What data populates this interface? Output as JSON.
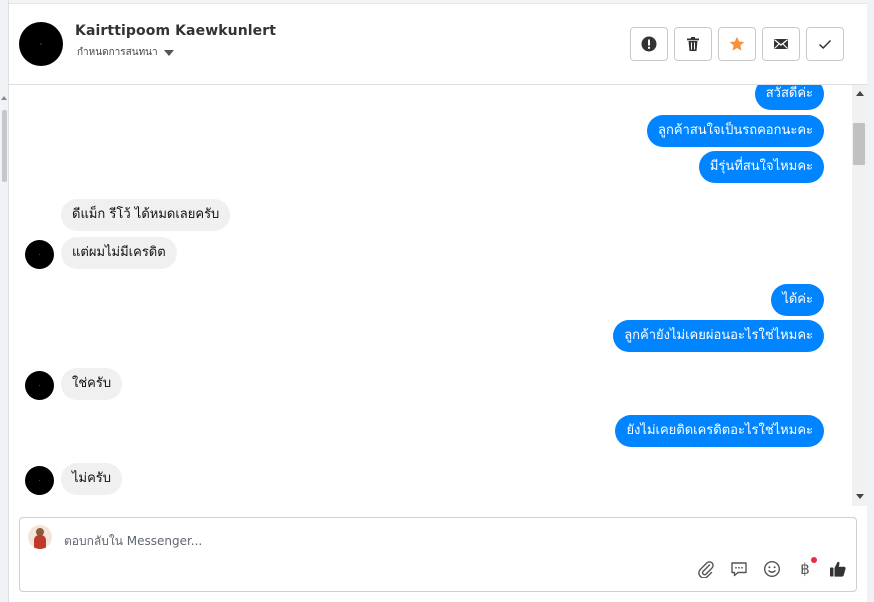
{
  "header": {
    "contact_name": "Kairttipoom Kaewkunlert",
    "assign_label": "กำหนดการสนทนา"
  },
  "actions": {
    "icons": [
      "alert-icon",
      "trash-icon",
      "star-icon",
      "mail-icon",
      "check-icon"
    ],
    "star_color": "#f7923a"
  },
  "messages": [
    {
      "side": "out",
      "text": "สวัสดีค่ะ"
    },
    {
      "side": "out",
      "text": "ลูกค้าสนใจเป็นรถคอกนะคะ"
    },
    {
      "side": "out",
      "text": "มีรุ่นที่สนใจไหมคะ"
    },
    {
      "side": "in",
      "text": "ดีแม็ก รีโว้ ได้หมดเลยครับ"
    },
    {
      "side": "in",
      "text": "แต่ผมไม่มีเครดิต"
    },
    {
      "side": "out",
      "text": "ได้ค่ะ"
    },
    {
      "side": "out",
      "text": "ลูกค้ายังไม่เคยผ่อนอะไรใช่ไหมคะ"
    },
    {
      "side": "in",
      "text": "ใช่ครับ"
    },
    {
      "side": "out",
      "text": "ยังไม่เคยติดเครดิตอะไรใช่ไหมคะ"
    },
    {
      "side": "in",
      "text": "ไม่ครับ"
    }
  ],
  "composer": {
    "placeholder": "ตอบกลับใน Messenger...",
    "tools": [
      "attachment-icon",
      "saved-reply-icon",
      "emoji-icon",
      "payment-icon",
      "like-icon"
    ],
    "payment_symbol": "฿"
  },
  "colors": {
    "outgoing_bubble": "#0084ff",
    "incoming_bubble": "#f0f0f0"
  }
}
